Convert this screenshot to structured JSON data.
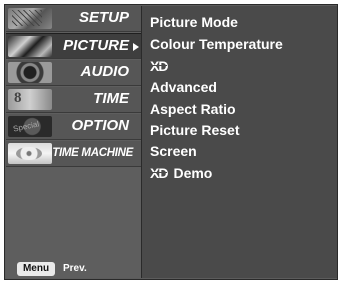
{
  "sidebar": {
    "items": [
      {
        "label": "SETUP",
        "thumb_icon": "setup-thumbnail-icon"
      },
      {
        "label": "PICTURE",
        "thumb_icon": "picture-thumbnail-icon",
        "selected": true
      },
      {
        "label": "AUDIO",
        "thumb_icon": "audio-thumbnail-icon"
      },
      {
        "label": "TIME",
        "thumb_icon": "time-thumbnail-icon"
      },
      {
        "label": "OPTION",
        "thumb_icon": "option-thumbnail-icon"
      },
      {
        "label": "TIME MACHINE",
        "thumb_icon": "time-machine-thumbnail-icon"
      }
    ]
  },
  "footer": {
    "menu_button": "Menu",
    "prev_label": "Prev."
  },
  "options": {
    "items": [
      {
        "label": "Picture Mode"
      },
      {
        "label": "Colour Temperature"
      },
      {
        "label": "XD",
        "kind": "logo"
      },
      {
        "label": "Advanced"
      },
      {
        "label": "Aspect Ratio"
      },
      {
        "label": "Picture Reset"
      },
      {
        "label": "Screen"
      },
      {
        "logo": "XD",
        "label": "Demo"
      }
    ]
  },
  "colors": {
    "panel_background": "#4a4a4a",
    "sidebar_background": "#5e5e5e",
    "selected_item_background": "#3e3e3e",
    "text": "#ffffff"
  }
}
